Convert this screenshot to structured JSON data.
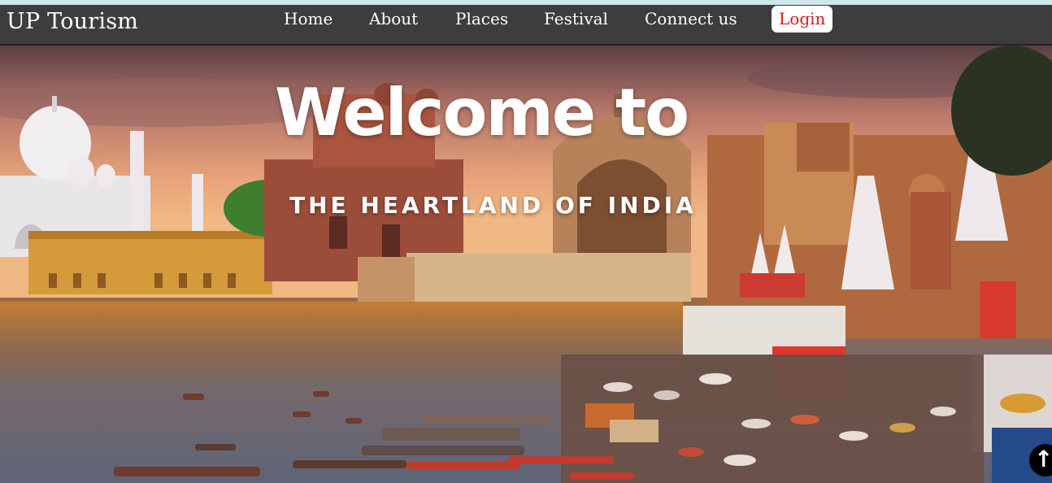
{
  "brand": {
    "name": "UP Tourism"
  },
  "nav": {
    "items": [
      {
        "label": "Home"
      },
      {
        "label": "About"
      },
      {
        "label": "Places"
      },
      {
        "label": "Festival"
      },
      {
        "label": "Connect us"
      }
    ],
    "login_label": "Login"
  },
  "hero": {
    "title": "Welcome to",
    "subtitle": "THE HEARTLAND OF INDIA"
  },
  "scroll_top": {
    "icon": "arrow-up-icon"
  },
  "colors": {
    "navbar": "#3d3d3d",
    "login_text": "#d81b1b",
    "topstrip": "#cfe6ea"
  }
}
